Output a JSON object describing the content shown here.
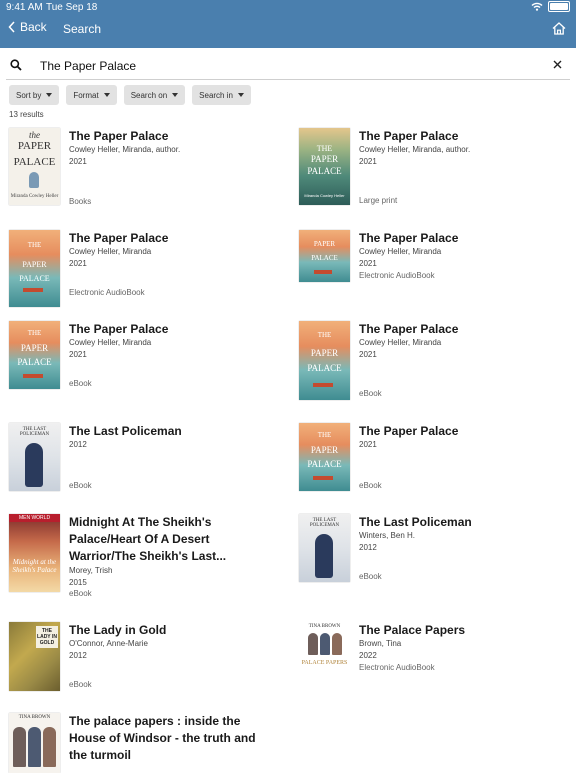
{
  "status": {
    "time": "9:41 AM",
    "date": "Tue Sep 18"
  },
  "nav": {
    "back_label": "Back",
    "title": "Search"
  },
  "search": {
    "value": "The Paper Palace"
  },
  "filters": [
    {
      "label": "Sort by"
    },
    {
      "label": "Format"
    },
    {
      "label": "Search on"
    },
    {
      "label": "Search in"
    }
  ],
  "results_count": "13 results",
  "results": [
    {
      "title": "The Paper Palace",
      "author": "Cowley Heller, Miranda, author.",
      "year": "2021",
      "format": "Books",
      "cover": "paper-palace-classic"
    },
    {
      "title": "The Paper Palace",
      "author": "Cowley Heller, Miranda, author.",
      "year": "2021",
      "format": "Large print",
      "cover": "paper-palace-green"
    },
    {
      "title": "The Paper Palace",
      "author": "Cowley Heller, Miranda",
      "year": "2021",
      "format": "Electronic AudioBook",
      "cover": "paper-palace-orange"
    },
    {
      "title": "The Paper Palace",
      "author": "Cowley Heller, Miranda",
      "year": "2021",
      "format": "Electronic AudioBook",
      "cover": "paper-palace-orange"
    },
    {
      "title": "The Paper Palace",
      "author": "Cowley Heller, Miranda",
      "year": "2021",
      "format": "eBook",
      "cover": "paper-palace-orange"
    },
    {
      "title": "The Paper Palace",
      "author": "Cowley Heller, Miranda",
      "year": "2021",
      "format": "eBook",
      "cover": "paper-palace-orange"
    },
    {
      "title": "The Last Policeman",
      "author": "",
      "year": "2012",
      "format": "eBook",
      "cover": "last-policeman"
    },
    {
      "title": "The Paper Palace",
      "author": "",
      "year": "2021",
      "format": "eBook",
      "cover": "paper-palace-orange"
    },
    {
      "title": "Midnight At The Sheikh's Palace/Heart Of A Desert Warrior/The Sheikh's Last...",
      "author": "Morey, Trish",
      "year": "2015",
      "format": "eBook",
      "cover": "sheikh"
    },
    {
      "title": "The Last Policeman",
      "author": "Winters, Ben H.",
      "year": "2012",
      "format": "eBook",
      "cover": "last-policeman"
    },
    {
      "title": "The Lady in Gold",
      "author": "O'Connor, Anne-Marie",
      "year": "2012",
      "format": "eBook",
      "cover": "lady-gold"
    },
    {
      "title": "The Palace Papers",
      "author": "Brown, Tina",
      "year": "2022",
      "format": "Electronic AudioBook",
      "cover": "palace-papers"
    },
    {
      "title": "The palace papers : inside the House of Windsor - the truth and the turmoil",
      "author": "",
      "year": "",
      "format": "",
      "cover": "palace-papers-print"
    }
  ],
  "cover_text": {
    "pp_the": "the",
    "pp_paper": "PAPER",
    "pp_palace": "PALACE",
    "pp_author": "Miranda Cowley Heller",
    "pp_the_caps": "THE",
    "lp_title": "THE LAST POLICEMAN",
    "mw_banner": "MEN WORLD",
    "mw_title": "Midnight at the Sheikh's Palace",
    "lg_title": "THE LADY IN GOLD",
    "tb_author": "TINA BROWN",
    "tb_title": "PALACE PAPERS"
  }
}
